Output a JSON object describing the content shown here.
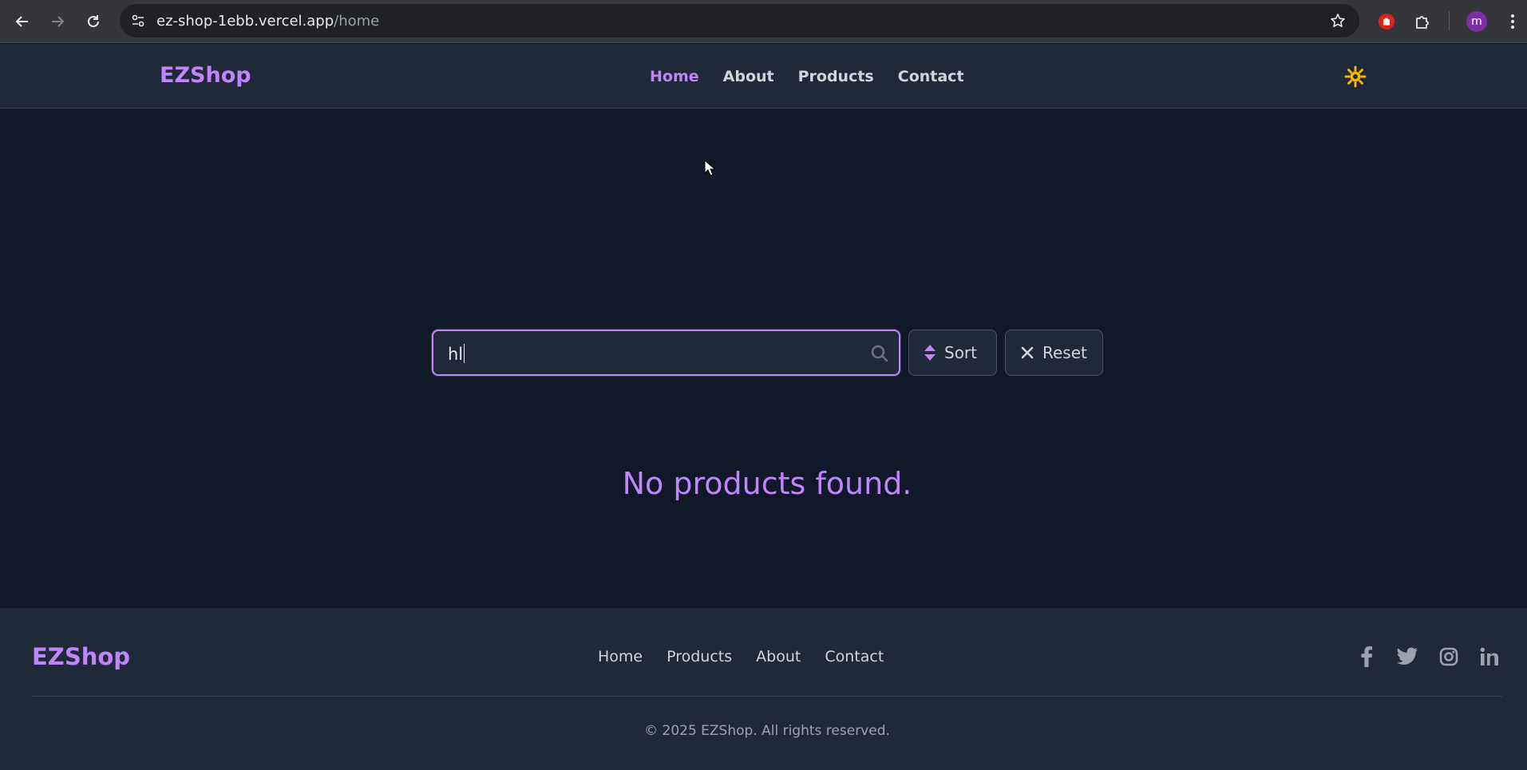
{
  "browser": {
    "url_host": "ez-shop-1ebb.vercel.app",
    "url_path": "/home",
    "profile_initial": "m",
    "icons": [
      "back-arrow-icon",
      "forward-arrow-icon",
      "reload-icon",
      "site-settings-icon",
      "bookmark-star-icon",
      "extension-hand-icon",
      "extensions-puzzle-icon",
      "kebab-menu-icon"
    ]
  },
  "header": {
    "logo": "EZShop",
    "nav": [
      {
        "label": "Home",
        "active": true
      },
      {
        "label": "About"
      },
      {
        "label": "Products"
      },
      {
        "label": "Contact"
      }
    ],
    "theme_icon": "sun-icon"
  },
  "search": {
    "value": "hl",
    "icon": "search-icon"
  },
  "buttons": {
    "sort_label": "Sort",
    "reset_label": "Reset"
  },
  "results": {
    "empty_message": "No products found."
  },
  "footer": {
    "logo": "EZShop",
    "nav": [
      {
        "label": "Home"
      },
      {
        "label": "Products"
      },
      {
        "label": "About"
      },
      {
        "label": "Contact"
      }
    ],
    "social": [
      "facebook-icon",
      "twitter-icon",
      "instagram-icon",
      "linkedin-icon"
    ],
    "copyright": "© 2025 EZShop. All rights reserved."
  },
  "colors": {
    "accent": "#c084fc",
    "page_bg": "#111827",
    "surface_bg": "#1f2937",
    "sun": "#f5b50a"
  }
}
